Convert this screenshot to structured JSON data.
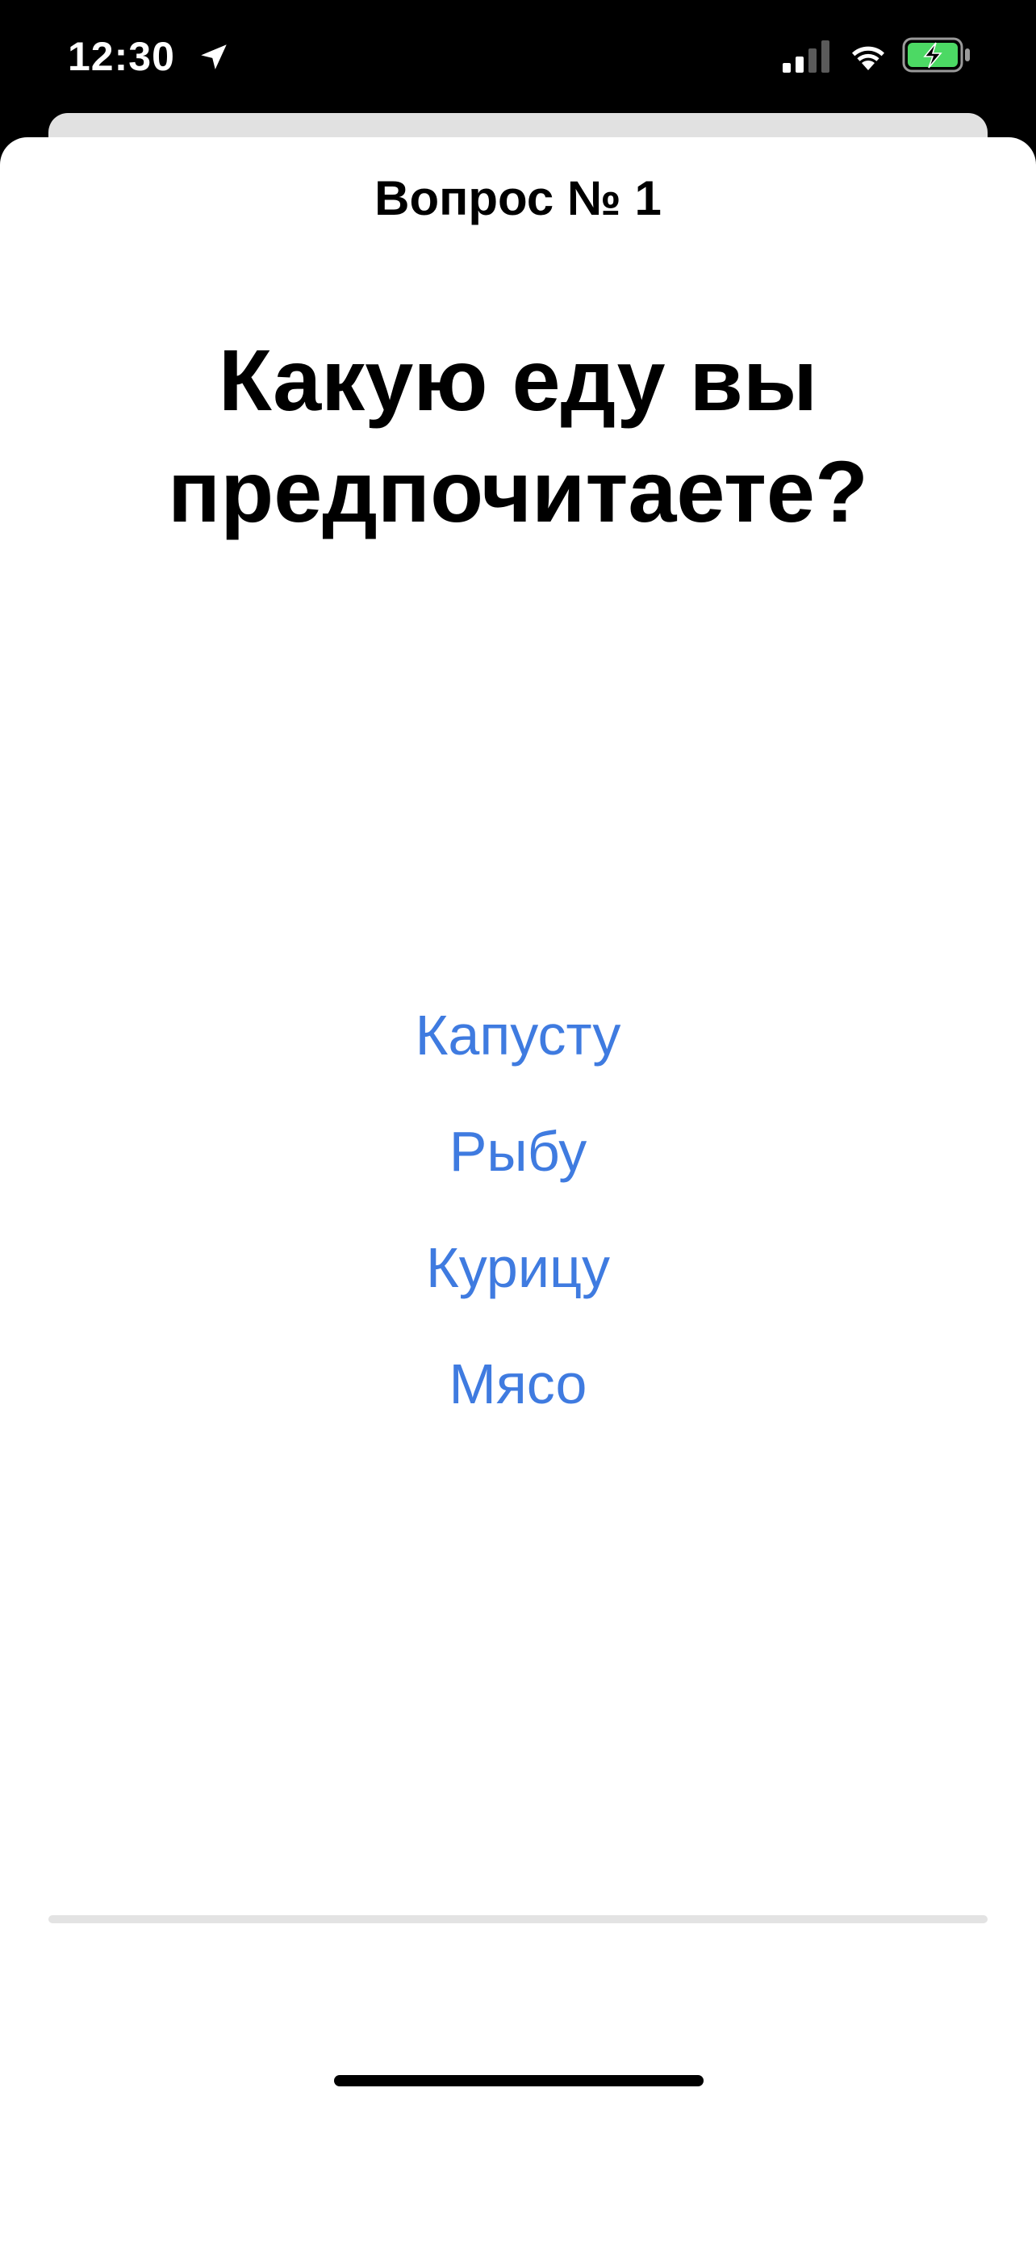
{
  "status_bar": {
    "time": "12:30",
    "icons": [
      "location-arrow-icon",
      "cellular-signal-icon",
      "wifi-icon",
      "battery-charging-icon"
    ],
    "battery_color": "#4cd964"
  },
  "quiz": {
    "question_number": "Вопрос № 1",
    "question": "Какую еду вы предпочитаете?",
    "answers": [
      "Капусту",
      "Рыбу",
      "Курицу",
      "Мясо"
    ]
  },
  "colors": {
    "accent": "#3f7be0",
    "background": "#ffffff",
    "status_bar": "#000000"
  }
}
